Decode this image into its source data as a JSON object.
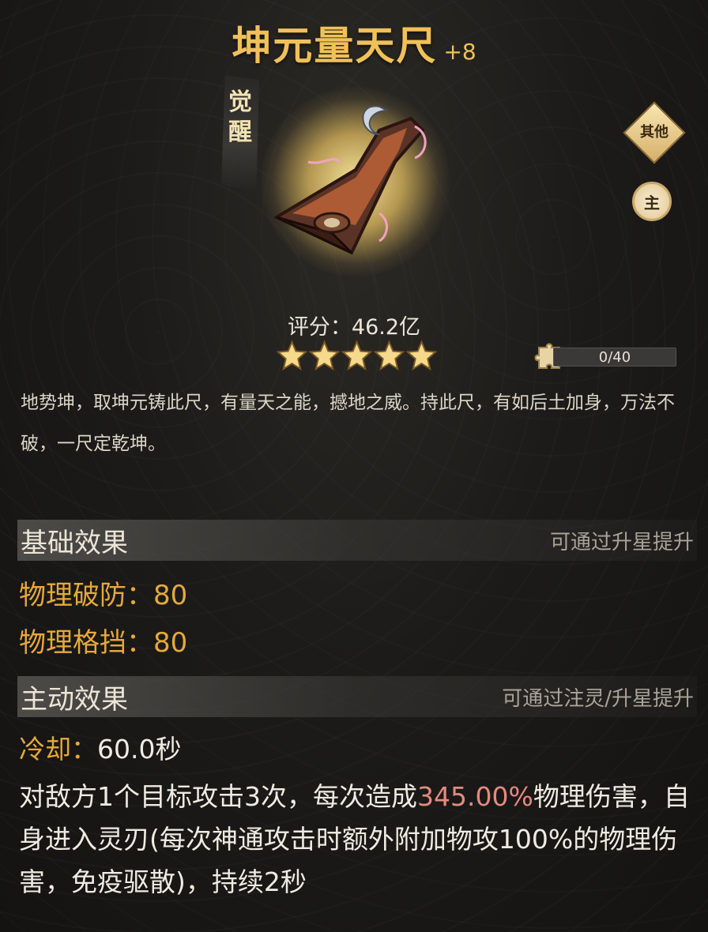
{
  "item": {
    "name": "坤元量天尺",
    "plus": "+8",
    "awaken_tag": [
      "觉",
      "醒"
    ],
    "score": "评分：46.2亿",
    "stars": 5,
    "fragment_progress": "0/40",
    "description": "地势坤，取坤元铸此尺，有量天之能，撼地之威。持此尺，有如后土加身，万法不破，一尺定乾坤。"
  },
  "side_buttons": {
    "other_label": "其他",
    "main_label": "主"
  },
  "basic_effect": {
    "title": "基础效果",
    "hint": "可通过升星提升",
    "stats": [
      {
        "label": "物理破防：",
        "value": "80"
      },
      {
        "label": "物理格挡：",
        "value": "80"
      }
    ]
  },
  "active_effect": {
    "title": "主动效果",
    "hint": "可通过注灵/升星提升",
    "cooldown_label": "冷却：",
    "cooldown_value": "60.0秒",
    "text_before": "对敌方1个目标攻击3次，每次造成",
    "highlight": "345.00%",
    "text_after": "物理伤害，自身进入灵刃(每次神通攻击时额外附加物攻100%的物理伤害，免疫驱散)，持续2秒"
  },
  "colors": {
    "title_gold": "#f0c15a",
    "stat_orange": "#e7a83a",
    "highlight_pink": "#e58a80"
  }
}
